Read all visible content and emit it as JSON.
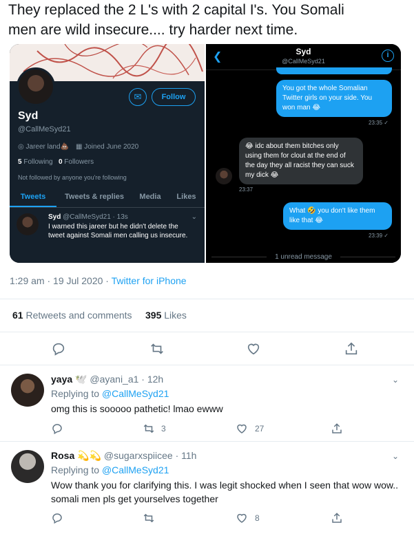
{
  "tweet": {
    "line1": "They replaced the 2 L's with 2 capital I's. You Somali",
    "line2": "men are wild insecure.... try harder next time."
  },
  "profile_shot": {
    "follow_label": "Follow",
    "name": "Syd",
    "handle": "@CallMeSyd21",
    "location": "Jareer land💩",
    "joined": "Joined June 2020",
    "following_count": "5",
    "following_label": "Following",
    "followers_count": "0",
    "followers_label": "Followers",
    "not_followed": "Not followed by anyone you're following",
    "tabs": [
      "Tweets",
      "Tweets & replies",
      "Media",
      "Likes"
    ],
    "mini_tweet": {
      "name": "Syd",
      "meta": "@CallMeSyd21 · 13s",
      "body": "I warned this jareer but he didn't delete the tweet against Somali men calling us insecure."
    }
  },
  "chat_shot": {
    "name": "Syd",
    "handle": "@CallMeSyd21",
    "msg1": "You got the whole Somalian Twitter girls on your side. You won man 😂",
    "time1": "23:35 ✓",
    "msg2": "😂 idc about them bitches only using them for clout at the end of the day they all racist they can suck my dick 😂",
    "time2": "23:37",
    "msg3": "What 🤣 you don't like them like that 😂",
    "time3": "23:39 ✓",
    "unread": "1 unread message"
  },
  "timestamp": {
    "time": "1:29 am · 19 Jul 2020 ·",
    "via": "Twitter for iPhone"
  },
  "stats": {
    "retweets": "61",
    "retweets_label": "Retweets and comments",
    "likes": "395",
    "likes_label": "Likes"
  },
  "replies": [
    {
      "name": "yaya",
      "emoji": "🕊️",
      "handle": "@ayani_a1 · 12h",
      "replying_prefix": "Replying to",
      "replying_to": "@CallMeSyd21",
      "body": "omg this is sooooo pathetic! lmao ewww",
      "retweets": "3",
      "likes": "27"
    },
    {
      "name": "Rosa",
      "emoji": "💫💫",
      "handle": "@sugarxspiicee · 11h",
      "replying_prefix": "Replying to",
      "replying_to": "@CallMeSyd21",
      "body": "Wow thank you for clarifying this. I was legit shocked when I seen that wow wow.. somali men pls get yourselves together",
      "retweets": "",
      "likes": "8"
    }
  ]
}
